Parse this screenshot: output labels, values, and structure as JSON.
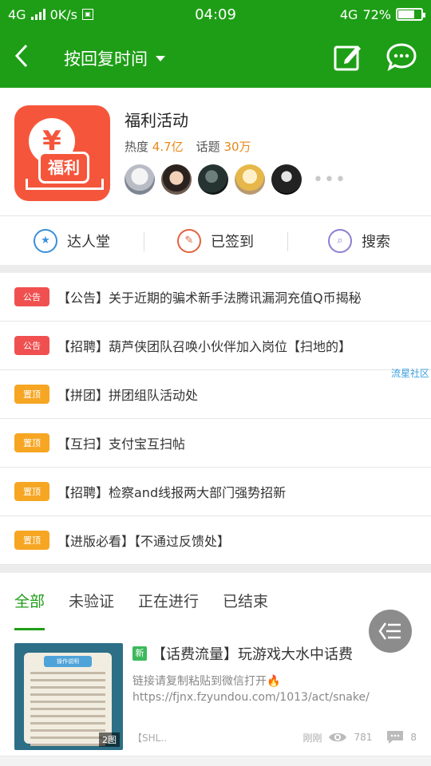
{
  "status_bar": {
    "network_left": "4G",
    "speed": "0K/s",
    "time": "04:09",
    "network_right": "4G",
    "battery": "72%",
    "battery_level": 0.72
  },
  "nav": {
    "title": "按回复时间"
  },
  "forum": {
    "name": "福利活动",
    "heat_label": "热度",
    "heat_value": "4.7亿",
    "topics_label": "话题",
    "topics_value": "30万",
    "logo_symbol": "¥",
    "logo_text": "福利",
    "more": "•••"
  },
  "quick_actions": [
    {
      "label": "达人堂",
      "icon": "star-icon",
      "color": "#3a8fd9"
    },
    {
      "label": "已签到",
      "icon": "pencil-icon",
      "color": "#e0623f"
    },
    {
      "label": "搜索",
      "icon": "search-icon",
      "color": "#8a7fd1"
    }
  ],
  "notices": [
    {
      "badge": "公告",
      "type": "red",
      "text": "【公告】关于近期的骗术新手法腾讯漏洞充值Q币揭秘"
    },
    {
      "badge": "公告",
      "type": "red",
      "text": "【招聘】葫芦侠团队召唤小伙伴加入岗位【扫地的】"
    },
    {
      "badge": "置顶",
      "type": "orange",
      "text": "【拼团】拼团组队活动处"
    },
    {
      "badge": "置顶",
      "type": "orange",
      "text": "【互扫】支付宝互扫帖"
    },
    {
      "badge": "置顶",
      "type": "orange",
      "text": "【招聘】检察and线报两大部门强势招新"
    },
    {
      "badge": "置顶",
      "type": "orange",
      "text": "【进版必看】【不通过反馈处】"
    }
  ],
  "watermark": "流星社区",
  "tabs": [
    {
      "label": "全部",
      "active": true
    },
    {
      "label": "未验证",
      "active": false
    },
    {
      "label": "正在进行",
      "active": false
    },
    {
      "label": "已结束",
      "active": false
    }
  ],
  "post": {
    "new_badge": "新",
    "title": "【话费流量】玩游戏大水中话费",
    "desc_line1": "链接请复制粘贴到微信打开🔥",
    "desc_line2": "https://fjnx.fzyundou.com/1013/act/snake/",
    "thumb_header": "操作说明",
    "image_count": "2图",
    "author": "【SHL..",
    "time": "刚刚",
    "views": "781",
    "comments": "8"
  },
  "colors": {
    "primary": "#1e9e16",
    "accent": "#e8891a",
    "notice_red": "#f05050",
    "notice_orange": "#f6a623"
  }
}
